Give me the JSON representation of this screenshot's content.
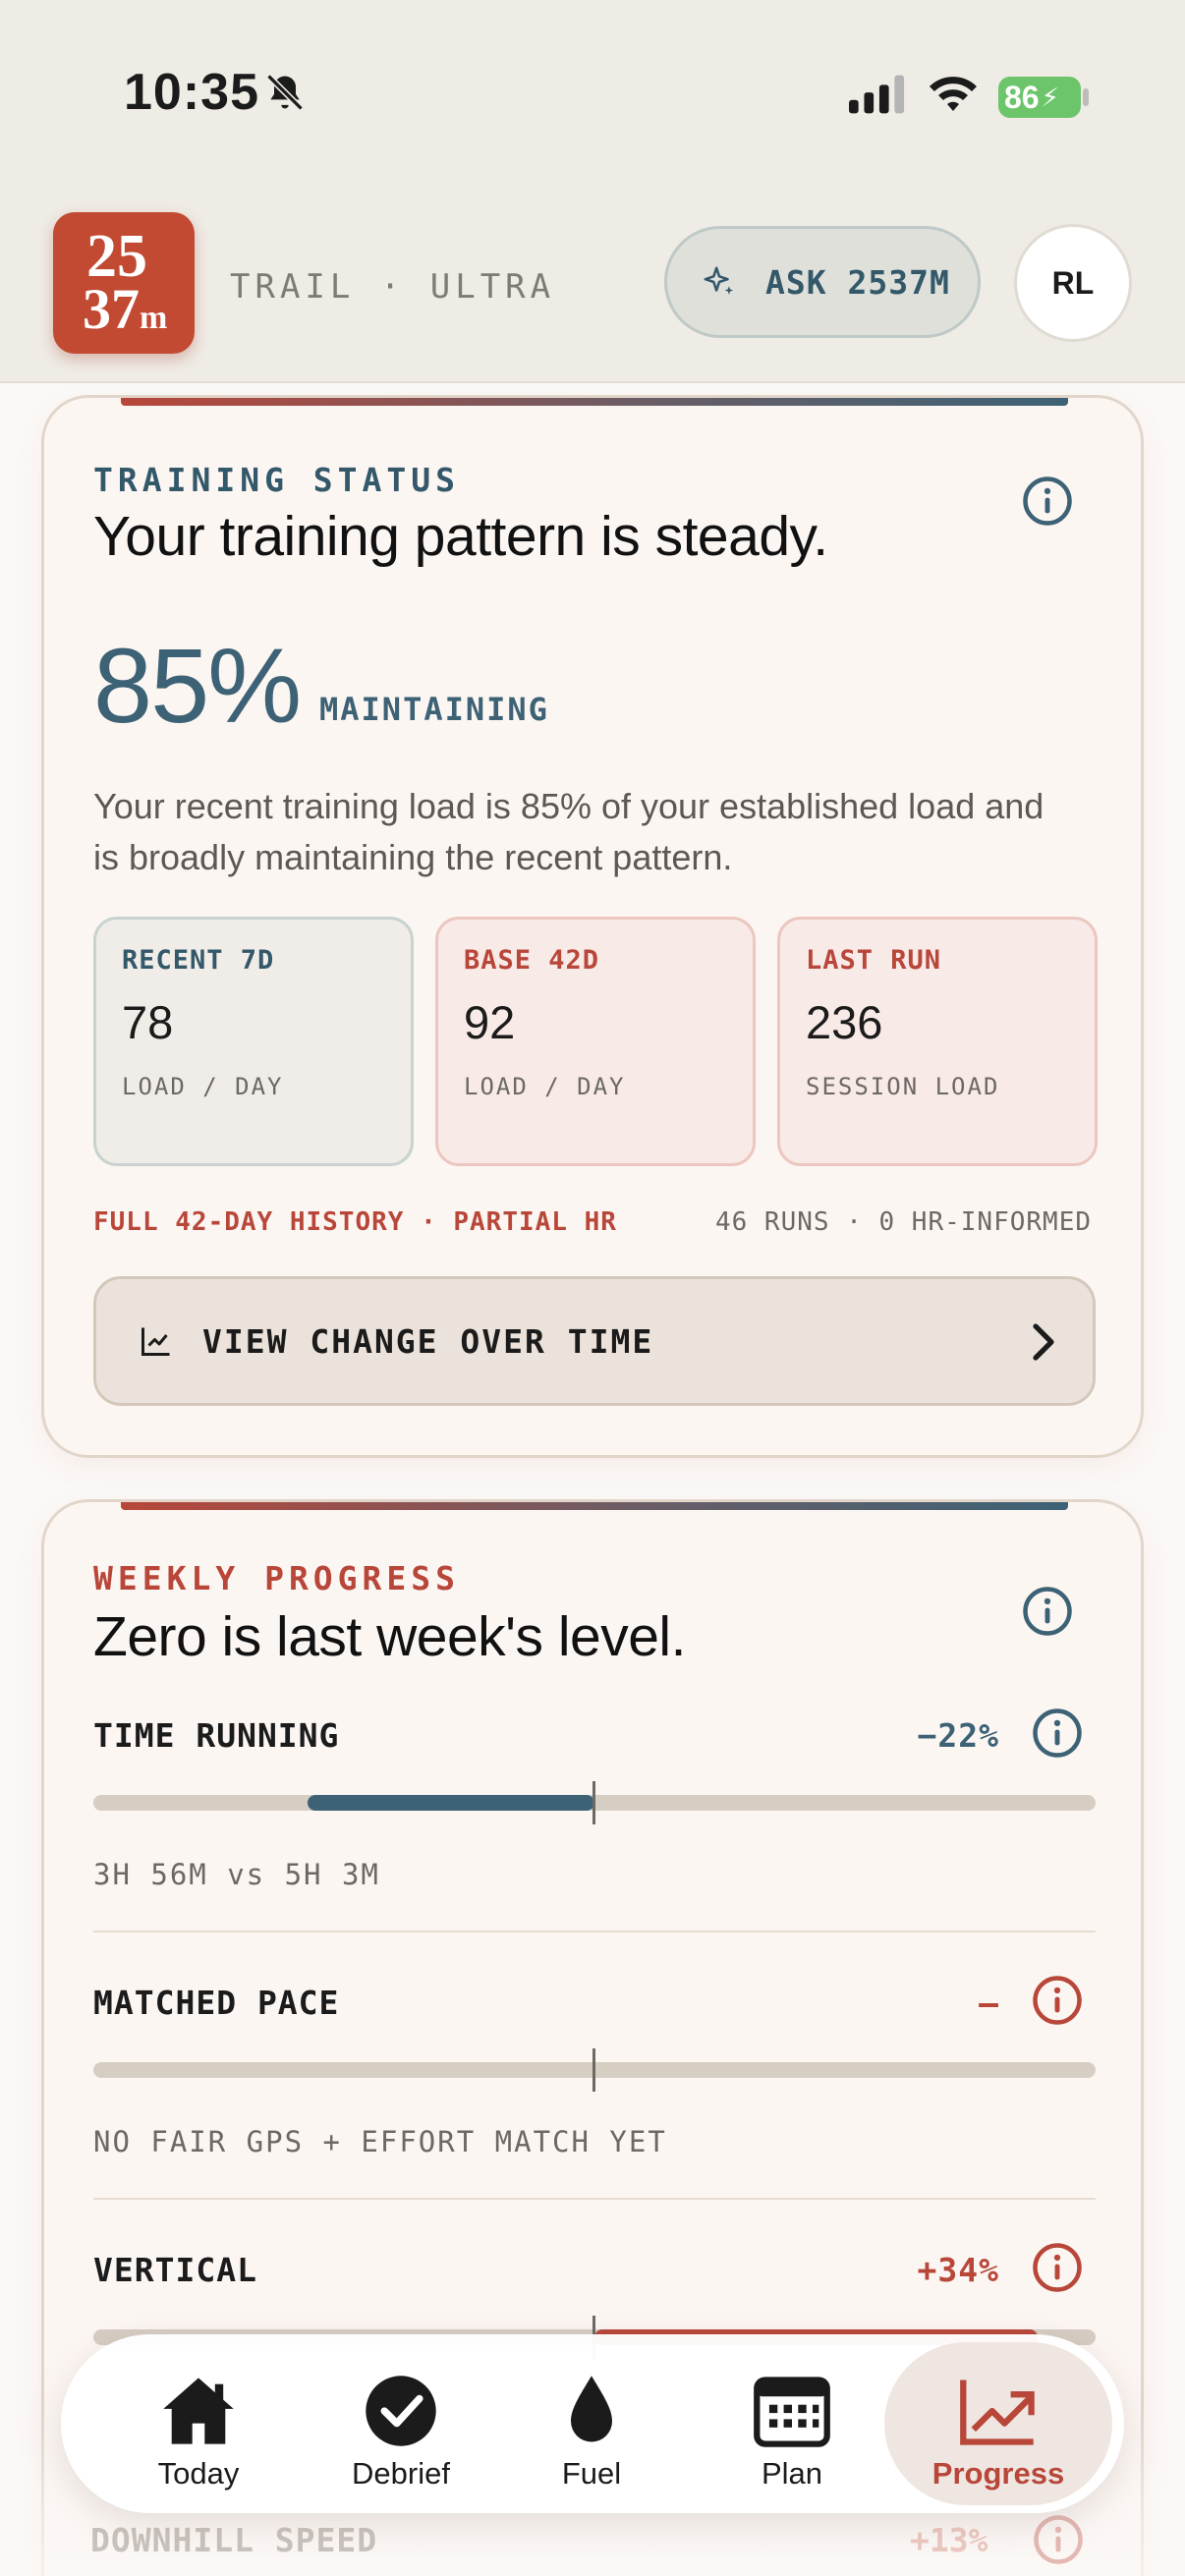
{
  "status_bar": {
    "time": "10:35",
    "battery": "86"
  },
  "header": {
    "logo_top": "25",
    "logo_bottom": "37",
    "logo_suffix": "m",
    "brand_tag": "TRAIL · ULTRA",
    "ask_label": "ASK 2537M",
    "avatar_initials": "RL"
  },
  "training_status": {
    "overline": "TRAINING STATUS",
    "headline": "Your training pattern is steady.",
    "percent": "85%",
    "percent_tag": "MAINTAINING",
    "description": "Your recent training load is 85% of your established load and is broadly maintaining the recent pattern.",
    "stats": [
      {
        "label": "RECENT 7D",
        "value": "78",
        "unit": "LOAD / DAY"
      },
      {
        "label": "BASE 42D",
        "value": "92",
        "unit": "LOAD / DAY"
      },
      {
        "label": "LAST RUN",
        "value": "236",
        "unit": "SESSION LOAD"
      }
    ],
    "history_left": "FULL 42-DAY HISTORY · PARTIAL HR",
    "history_right": "46 RUNS · 0 HR-INFORMED",
    "view_button": "VIEW CHANGE OVER TIME"
  },
  "weekly_progress": {
    "overline": "WEEKLY PROGRESS",
    "headline": "Zero is last week's level.",
    "metrics": [
      {
        "name": "TIME RUNNING",
        "value": "−22%",
        "sub": "3H 56M vs 5H 3M",
        "change_fraction": -0.22,
        "color": "#3d6275"
      },
      {
        "name": "MATCHED PACE",
        "value": "–",
        "sub": "NO FAIR GPS + EFFORT MATCH YET",
        "change_fraction": 0,
        "color": "#b8473a"
      },
      {
        "name": "VERTICAL",
        "value": "+34%",
        "sub": "",
        "change_fraction": 0.34,
        "color": "#b8473a"
      }
    ],
    "partial_next": {
      "name": "DOWNHILL SPEED",
      "value": "+13%"
    }
  },
  "tabs": [
    {
      "label": "Today",
      "icon": "home-icon"
    },
    {
      "label": "Debrief",
      "icon": "check-circle-icon"
    },
    {
      "label": "Fuel",
      "icon": "drop-icon"
    },
    {
      "label": "Plan",
      "icon": "calendar-icon"
    },
    {
      "label": "Progress",
      "icon": "trend-icon"
    }
  ],
  "colors": {
    "accent_red": "#b8473a",
    "accent_blue": "#3d6275",
    "logo": "#c24a33"
  }
}
